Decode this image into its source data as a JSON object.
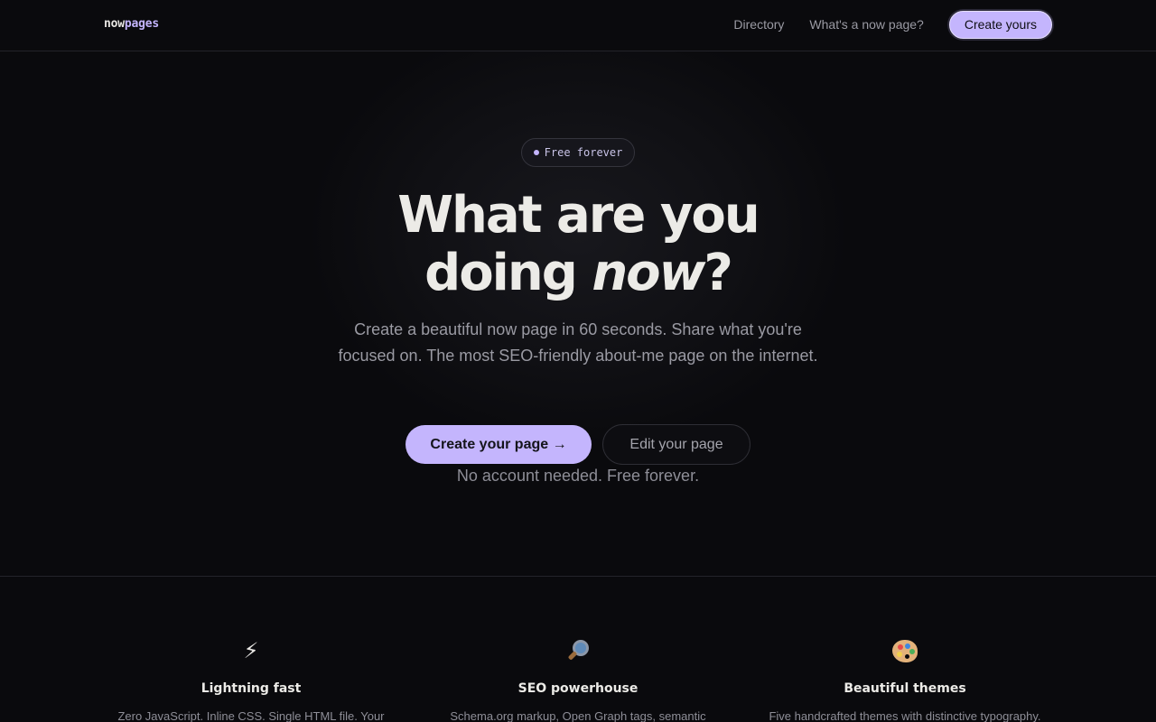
{
  "header": {
    "logo_part1": "now",
    "logo_part2": "pages",
    "nav": {
      "directory": "Directory",
      "whats_now": "What's a now page?",
      "create_yours": "Create yours"
    }
  },
  "hero": {
    "badge": "Free forever",
    "headline_line1": "What are you",
    "headline_line2_start": "doing ",
    "headline_line2_em": "now",
    "headline_line2_end": "?",
    "subtext": "Create a beautiful now page in 60 seconds. Share what you're focused on. The most SEO-friendly about-me page on the internet.",
    "primary_cta": "Create your page →",
    "secondary_cta": "Edit your page",
    "note": "No account needed. Free forever."
  },
  "features": [
    {
      "icon": "lightning-bolt-icon",
      "glyph": "⚡",
      "title": "Lightning fast",
      "desc": "Zero JavaScript. Inline CSS. Single HTML file. Your"
    },
    {
      "icon": "magnifying-glass-icon",
      "title": "SEO powerhouse",
      "desc": "Schema.org markup, Open Graph tags, semantic"
    },
    {
      "icon": "palette-icon",
      "title": "Beautiful themes",
      "desc": "Five handcrafted themes with distinctive typography."
    }
  ],
  "colors": {
    "background": "#0a0a0d",
    "accent": "#c4b5fd",
    "text": "#ecebe7",
    "muted": "#9a9aa3"
  }
}
